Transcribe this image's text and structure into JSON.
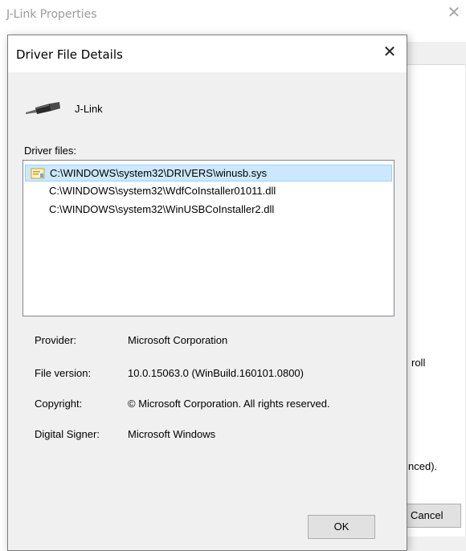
{
  "parent": {
    "title": "J-Link Properties",
    "frag_scroll": "roll",
    "frag_advanced": "nced).",
    "cancel_label": "Cancel"
  },
  "dialog": {
    "title": "Driver File Details",
    "device_name": "J-Link",
    "files_label": "Driver files:",
    "files": [
      "C:\\WINDOWS\\system32\\DRIVERS\\winusb.sys",
      "C:\\WINDOWS\\system32\\WdfCoInstaller01011.dll",
      "C:\\WINDOWS\\system32\\WinUSBCoInstaller2.dll"
    ],
    "selected_index": 0,
    "info": {
      "provider_label": "Provider:",
      "provider_value": "Microsoft Corporation",
      "version_label": "File version:",
      "version_value": "10.0.15063.0 (WinBuild.160101.0800)",
      "copyright_label": "Copyright:",
      "copyright_value": "© Microsoft Corporation. All rights reserved.",
      "signer_label": "Digital Signer:",
      "signer_value": "Microsoft Windows"
    },
    "ok_label": "OK"
  },
  "icons": {
    "close": "close-icon",
    "device": "usb-plug-icon",
    "file": "driver-file-icon"
  }
}
